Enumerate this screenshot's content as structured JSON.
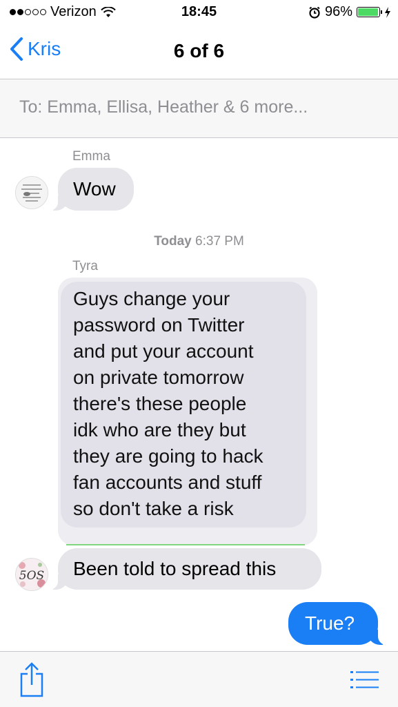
{
  "status_bar": {
    "carrier": "Verizon",
    "time": "18:45",
    "battery_percent": "96%",
    "signal_bars_filled": 2,
    "signal_bars_total": 5,
    "battery_level": 0.96,
    "accent_battery": "#4cd964"
  },
  "nav": {
    "back_label": "Kris",
    "title": "6 of 6",
    "accent": "#1a7ef5"
  },
  "recipients": {
    "text": "To: Emma, Ellisa, Heather & 6 more..."
  },
  "messages": [
    {
      "sender": "Emma",
      "text": "Wow",
      "direction": "incoming"
    },
    {
      "timestamp_day": "Today",
      "timestamp_time": "6:37 PM"
    },
    {
      "sender": "Tyra",
      "lines": [
        "Guys change your",
        "password on Twitter",
        "and put your account",
        "on private tomorrow",
        "there's these people",
        "idk who are they but",
        "they are going to hack",
        "fan accounts and stuff",
        "so don't take a risk"
      ],
      "direction": "incoming"
    },
    {
      "text": "Been told to spread this",
      "direction": "incoming"
    },
    {
      "text": "True?",
      "direction": "outgoing"
    }
  ],
  "toolbar": {
    "share_icon": "share-icon",
    "list_icon": "list-icon"
  }
}
